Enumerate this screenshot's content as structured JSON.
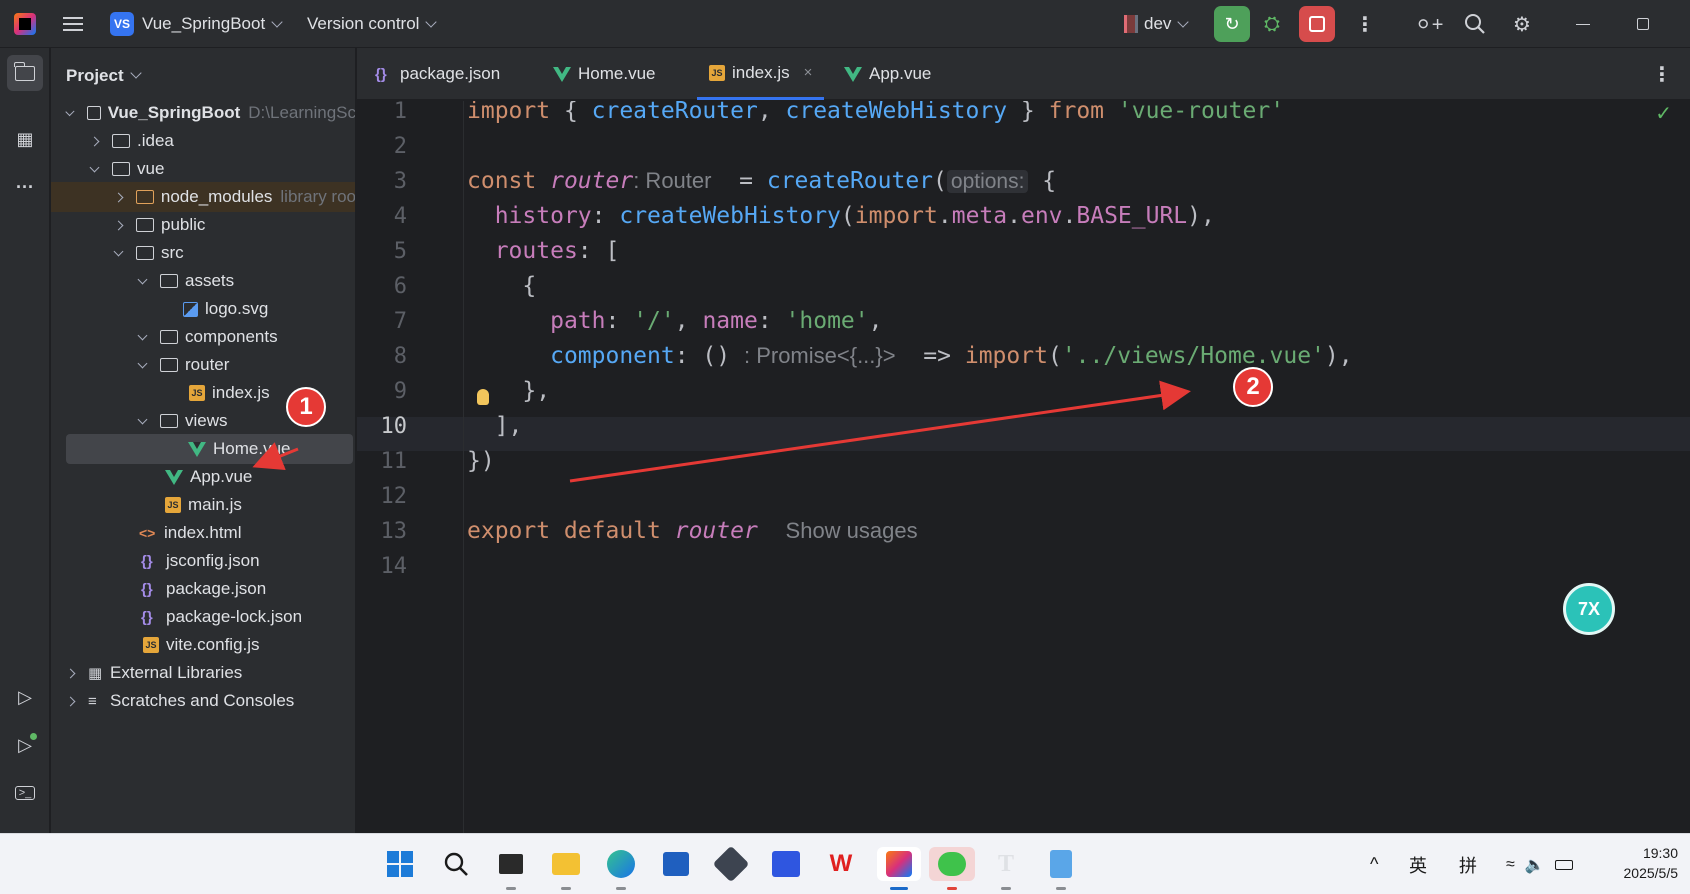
{
  "titlebar": {
    "project_badge": "VS",
    "project_name": "Vue_SpringBoot",
    "version_control": "Version control",
    "branch": "dev"
  },
  "project_panel": {
    "title": "Project",
    "tree": [
      {
        "label": "Vue_SpringBoot",
        "hint": "D:\\LearningSc",
        "type": "module",
        "expanded": true
      },
      {
        "label": ".idea",
        "type": "folder",
        "expanded": false
      },
      {
        "label": "vue",
        "type": "folder",
        "expanded": true
      },
      {
        "label": "node_modules",
        "hint": "library roo",
        "type": "folder-excluded",
        "expanded": false
      },
      {
        "label": "public",
        "type": "folder",
        "expanded": false
      },
      {
        "label": "src",
        "type": "folder",
        "expanded": true
      },
      {
        "label": "assets",
        "type": "folder",
        "expanded": true
      },
      {
        "label": "logo.svg",
        "type": "svg"
      },
      {
        "label": "components",
        "type": "folder",
        "expanded": true
      },
      {
        "label": "router",
        "type": "folder",
        "expanded": true
      },
      {
        "label": "index.js",
        "type": "js"
      },
      {
        "label": "views",
        "type": "folder",
        "expanded": true
      },
      {
        "label": "Home.vue",
        "type": "vue",
        "selected": true
      },
      {
        "label": "App.vue",
        "type": "vue"
      },
      {
        "label": "main.js",
        "type": "js"
      },
      {
        "label": "index.html",
        "type": "html"
      },
      {
        "label": "jsconfig.json",
        "type": "json"
      },
      {
        "label": "package.json",
        "type": "json"
      },
      {
        "label": "package-lock.json",
        "type": "json"
      },
      {
        "label": "vite.config.js",
        "type": "js"
      },
      {
        "label": "External Libraries",
        "type": "library",
        "expanded": false
      },
      {
        "label": "Scratches and Consoles",
        "type": "scratches",
        "expanded": false
      }
    ]
  },
  "tabs": [
    {
      "label": "package.json",
      "icon": "json-icon"
    },
    {
      "label": "Home.vue",
      "icon": "vue-icon"
    },
    {
      "label": "index.js",
      "icon": "js-icon",
      "active": true,
      "close": "×"
    },
    {
      "label": "App.vue",
      "icon": "vue-icon"
    }
  ],
  "editor": {
    "current_line": 10,
    "line_numbers": [
      "1",
      "2",
      "3",
      "4",
      "5",
      "6",
      "7",
      "8",
      "9",
      "10",
      "11",
      "12",
      "13",
      "14"
    ],
    "l1": {
      "kw": "import",
      "p1": " { ",
      "f1": "createRouter",
      "p2": ", ",
      "f2": "createWebHistory",
      "p3": " } ",
      "kw2": "from",
      "sp": " ",
      "s1": "'vue-router'"
    },
    "l3": {
      "kw": "const",
      "sp": " ",
      "var": "router",
      "type_hint": ": Router",
      "p1": "  = ",
      "fn": "createRouter",
      "p2": "(",
      "param_hint": "options:",
      "p3": " {"
    },
    "l4": {
      "ind": "  ",
      "prop": "history",
      "p1": ": ",
      "fn": "createWebHistory",
      "p2": "(",
      "kw": "import",
      "p3": ".",
      "meta": "meta",
      "p4": ".",
      "env": "env",
      "p5": ".",
      "base": "BASE_URL",
      "p6": "),"
    },
    "l5": {
      "ind": "  ",
      "prop": "routes",
      "p1": ": ["
    },
    "l6": {
      "text": "    {"
    },
    "l7": {
      "ind": "      ",
      "prop1": "path",
      "p1": ": ",
      "s1": "'/'",
      "p2": ", ",
      "prop2": "name",
      "p3": ": ",
      "s2": "'home'",
      "p4": ","
    },
    "l8": {
      "ind": "      ",
      "prop": "component",
      "p1": ": () ",
      "type_hint": ": Promise<{...}>",
      "p2": "  => ",
      "kw": "import",
      "p3": "(",
      "s": "'../views/Home.vue'",
      "p4": "),"
    },
    "l9": {
      "text": "    },"
    },
    "l10": {
      "text": "  ],"
    },
    "l11": {
      "text": "})"
    },
    "l13": {
      "kw": "export default",
      "sp": " ",
      "var": "router",
      "usages": "Show usages"
    }
  },
  "annotations": {
    "badge1": "1",
    "badge2": "2"
  },
  "mascot": "7X",
  "taskbar": {
    "tray_caret": "^",
    "ime1": "英",
    "ime2": "拼",
    "time": "19:30",
    "date": "2025/5/5"
  }
}
